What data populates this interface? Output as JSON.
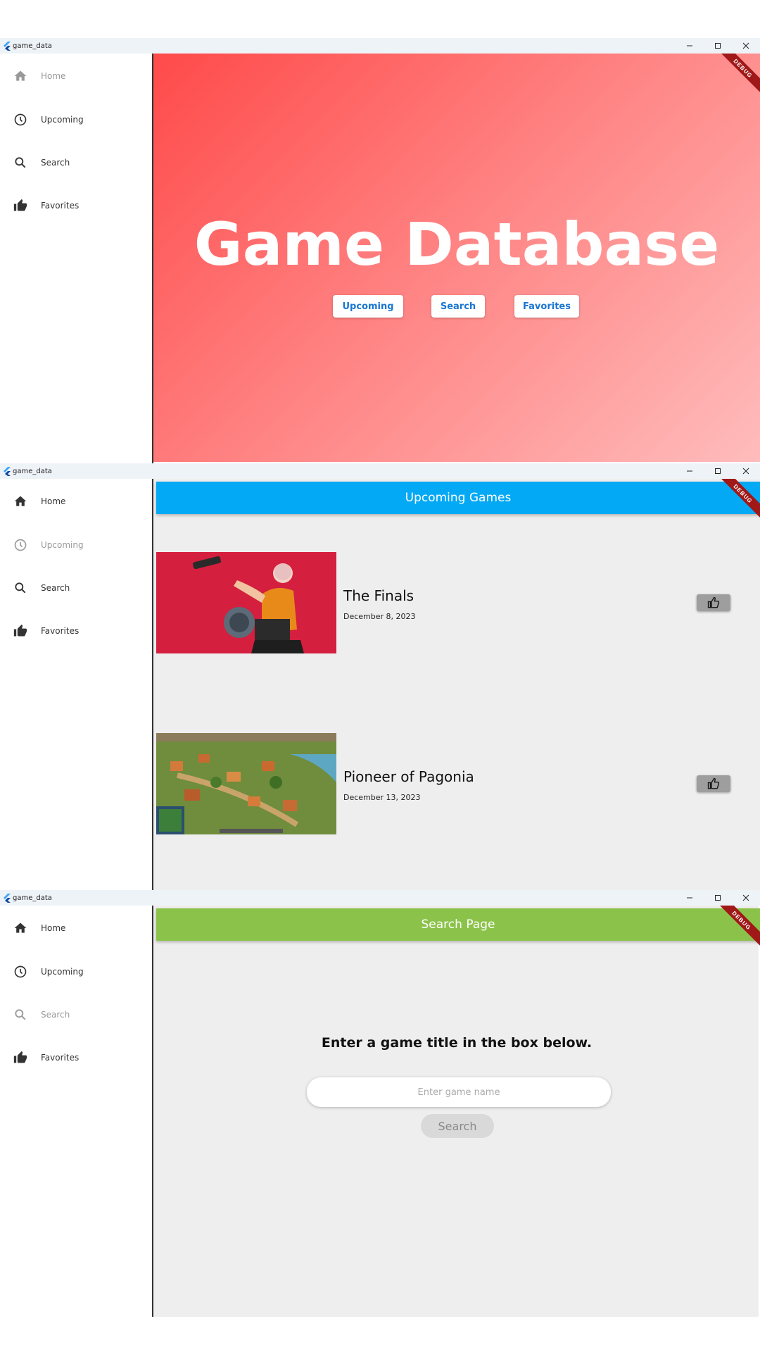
{
  "app_name": "game_data",
  "nav_items": [
    "Home",
    "Upcoming",
    "Search",
    "Favorites"
  ],
  "debug_label": "DEBUG",
  "colors": {
    "hero_gradient_start": "#ff4a4a",
    "hero_gradient_end": "#ffbcbc",
    "upcoming_appbar": "#03a9f4",
    "search_appbar": "#8bc34a",
    "hero_button_text": "#1976d2"
  },
  "home": {
    "title": "Game Database",
    "buttons": [
      "Upcoming",
      "Search",
      "Favorites"
    ]
  },
  "upcoming": {
    "appbar_title": "Upcoming Games",
    "games": [
      {
        "title": "The Finals",
        "date": "December 8, 2023"
      },
      {
        "title": "Pioneer of Pagonia",
        "date": "December 13, 2023"
      }
    ]
  },
  "search": {
    "appbar_title": "Search Page",
    "heading": "Enter a game title in the box below.",
    "input_value": "",
    "input_placeholder": "Enter game name",
    "button_label": "Search"
  }
}
